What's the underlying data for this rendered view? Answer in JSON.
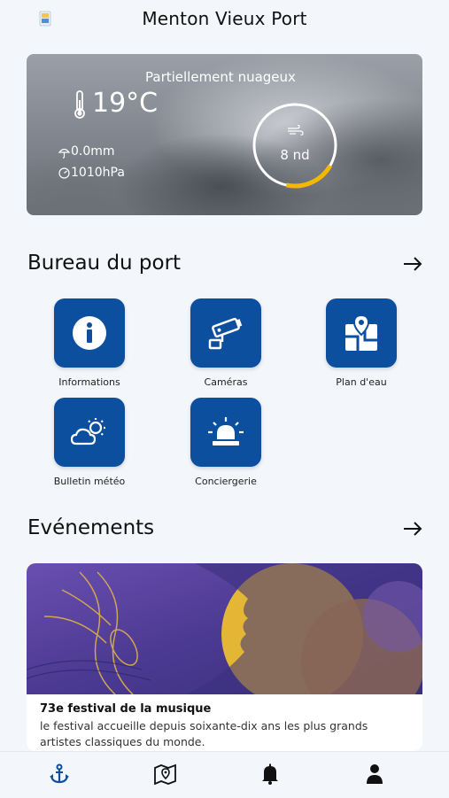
{
  "header": {
    "title": "Menton Vieux Port",
    "logo_icon": "port-crest-logo"
  },
  "weather": {
    "condition": "Partiellement nuageux",
    "temperature": "19°C",
    "rain": "0.0mm",
    "pressure": "1010hPa",
    "wind_speed": "8 nd",
    "wind_gauge_fraction": 0.2,
    "accent_color": "#f5b800"
  },
  "bureau": {
    "title": "Bureau du port",
    "items": [
      {
        "label": "Informations",
        "icon": "info-icon"
      },
      {
        "label": "Caméras",
        "icon": "camera-icon"
      },
      {
        "label": "Plan d'eau",
        "icon": "map-pin-icon"
      },
      {
        "label": "Bulletin météo",
        "icon": "weather-icon"
      },
      {
        "label": "Conciergerie",
        "icon": "siren-icon"
      }
    ]
  },
  "events": {
    "title": "Evénements",
    "items": [
      {
        "title": "73e festival de la musique",
        "description": "le festival accueille depuis soixante-dix ans les plus grands artistes classiques du monde."
      }
    ]
  },
  "nav": {
    "items": [
      "anchor-icon",
      "map-icon",
      "bell-icon",
      "user-icon"
    ],
    "active_color": "#0b4f9e"
  },
  "colors": {
    "primary": "#0b4f9e",
    "background": "#f3f6fa"
  }
}
